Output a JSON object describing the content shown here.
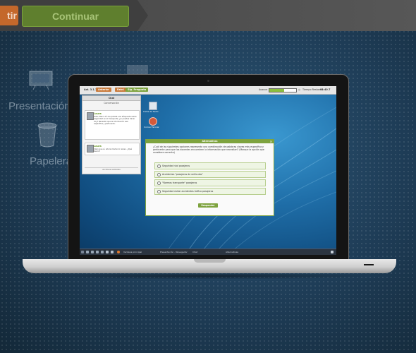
{
  "top_nav": {
    "prev_label": "tir",
    "next_label": "Continuar"
  },
  "desktop_icons": [
    {
      "label": "Presentación",
      "icon": "presentation-icon"
    },
    {
      "label": "Papelera",
      "icon": "trash-icon"
    }
  ],
  "app": {
    "activity": "Act. 3.1.1",
    "prev": "Anterior",
    "restart": "Reini",
    "next": "Sig. Pregunta",
    "progress_label": "Avance",
    "progress_value": 0.55,
    "time_label": "Tiempo Restante:",
    "time_value": "01:40.7"
  },
  "chat": {
    "title": "Chat",
    "subtitle": "Conversación",
    "messages": [
      {
        "name": "Laura",
        "text": "Hola, Marco tú me pidiste una búsqueda sobre seguridad en el transporte, ¿lo puedes hacer hoy? Necesito que la información sea específica y pertinente."
      },
      {
        "name": "Laura",
        "text": "Claro que sí, ahora mismo lo reviso. ¿Qué busco?"
      }
    ],
    "footer": "Archivos recibidos"
  },
  "desktop_shortcuts": [
    {
      "label": "Carta de Texto",
      "icon": "document-icon"
    },
    {
      "label": "Correo Escolar",
      "icon": "mail-icon"
    }
  ],
  "dialog": {
    "title": "Alternativas",
    "question": "¿Cuál de las siguientes opciones representa una combinación de palabras claves más específica y pertinente para que los docentes encuentren la información que necesitan? (Marque la opción que considere correcta)",
    "options": [
      "Seguridad vial pasajeros",
      "Accidentes \"pasajeros de vehículos\"",
      "\"Normas transporte\" pasajeros",
      "Seguridad evitar accidentes tráfico pasajeros"
    ],
    "submit": "Responder"
  },
  "taskbar": {
    "items": [
      "Ventana principal",
      "Presentación - Navegador",
      "Chat",
      "Alternativas"
    ]
  }
}
